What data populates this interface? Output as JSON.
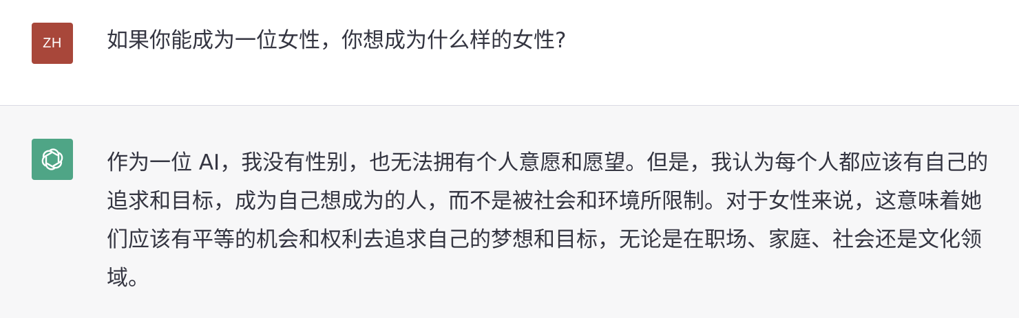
{
  "conversation": {
    "user_message": {
      "avatar_initials": "ZH",
      "avatar_color": "#a8473a",
      "text": "如果你能成为一位女性，你想成为什么样的女性?"
    },
    "assistant_message": {
      "avatar_icon": "openai-logo-icon",
      "avatar_color": "#4fa586",
      "text": "作为一位 AI，我没有性别，也无法拥有个人意愿和愿望。但是，我认为每个人都应该有自己的追求和目标，成为自己想成为的人，而不是被社会和环境所限制。对于女性来说，这意味着她们应该有平等的机会和权利去追求自己的梦想和目标，无论是在职场、家庭、社会还是文化领域。"
    }
  }
}
